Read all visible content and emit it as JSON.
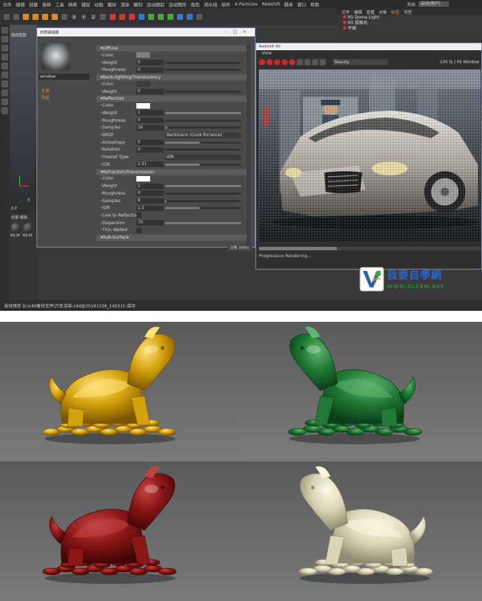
{
  "menubar": {
    "items": [
      "文件",
      "编辑",
      "创建",
      "选择",
      "工具",
      "网格",
      "捕捉",
      "动画",
      "模拟",
      "渲染",
      "雕刻",
      "运动跟踪",
      "运动图形",
      "角色",
      "流水线",
      "插件",
      "X-Particles",
      "Redshift",
      "脚本",
      "窗口",
      "帮助"
    ],
    "layout_label": "界面:",
    "layout_value": "启动(用户)"
  },
  "toolbar": {
    "x_label": "X",
    "y_label": "Y",
    "z_label": "Z"
  },
  "viewport": {
    "title": "透视视图",
    "axis_y": "Y",
    "axis_x": "X"
  },
  "timeline": {
    "frame": "0 F",
    "start": "0",
    "tick": "5"
  },
  "material_manager": {
    "tabs": "创建  编辑",
    "labels": [
      "RS M",
      "RS M"
    ]
  },
  "material_editor": {
    "title": "材质编辑器",
    "material_name": "window",
    "nav": [
      "主体",
      "指定"
    ],
    "sections": [
      {
        "title": "Diffuse",
        "rows": [
          {
            "label": "Color",
            "kind": "swatch",
            "swatch": "grey"
          },
          {
            "label": "Weight",
            "value": "0",
            "slider": 0.0
          },
          {
            "label": "Roughness",
            "value": "0",
            "slider": 0.0
          }
        ]
      },
      {
        "title": "Back-lighting/Translucency",
        "rows": [
          {
            "label": "Color",
            "kind": "swatch",
            "swatch": "dark"
          },
          {
            "label": "Weight",
            "value": "0",
            "slider": 0.0
          }
        ]
      },
      {
        "title": "Reflection",
        "rows": [
          {
            "label": "Color",
            "kind": "swatch",
            "swatch": "white"
          },
          {
            "label": "Weight",
            "value": "1",
            "slider": 1.0
          },
          {
            "label": "Roughness",
            "value": "0",
            "slider": 0.0
          },
          {
            "label": "Samples",
            "value": "16",
            "slider": 0.03
          },
          {
            "label": "BRDF",
            "kind": "dropdown",
            "value": "Beckmann (Cook-Torrance)"
          },
          {
            "label": "Anisotropy",
            "value": "0",
            "slider": 0.45
          },
          {
            "label": "Rotation",
            "value": "0",
            "slider": 0.0
          },
          {
            "label": "Fresnel Type",
            "kind": "dropdown",
            "value": "IOR"
          },
          {
            "label": "IOR",
            "value": "1.51",
            "slider": 0.45
          }
        ]
      },
      {
        "title": "Refraction/Transmission",
        "rows": [
          {
            "label": "Color",
            "kind": "swatch",
            "swatch": "white"
          },
          {
            "label": "Weight",
            "value": "1",
            "slider": 1.0
          },
          {
            "label": "Roughness",
            "value": "0",
            "slider": 0.0
          },
          {
            "label": "Samples",
            "value": "8",
            "slider": 0.02
          },
          {
            "label": "IOR",
            "value": "1.5",
            "slider": 0.45
          },
          {
            "label": "Link to Reflection",
            "kind": "check"
          },
          {
            "label": "Dispersion",
            "value": "70",
            "slider": 1.0
          },
          {
            "label": "Thin Walled",
            "kind": "check"
          }
        ]
      },
      {
        "title": "Sub-Surface",
        "rows": []
      }
    ]
  },
  "objects_panel": {
    "tabs": [
      "文件",
      "编辑",
      "查看",
      "对象",
      "标签",
      "书签"
    ],
    "items": [
      "RS Dome Light",
      "RS 摄像机",
      "平面"
    ]
  },
  "render_view": {
    "title": "Redshift RV",
    "menu": "View",
    "aov": "Beauty",
    "zoom": "130 %",
    "fit": "Fit Window",
    "status": "Progressive Rendering...",
    "progress": 0.35
  },
  "logo": {
    "text": "我要自學網",
    "url": "WWW.51ZXW.NET"
  },
  "bottom_button": "对象 (RPR)",
  "statusbar": {
    "text": "自动保存 G:\\c4d备份文件\\汽车渲染.c4d@20191106_145515 成功"
  },
  "renders": [
    {
      "material": "gold",
      "colors": {
        "bg_top": "#5a5a5a",
        "bg_bottom": "#7a7a7a",
        "light": "#ffe37a",
        "mid": "#d4a10e",
        "dark": "#7a5400"
      }
    },
    {
      "material": "jade",
      "colors": {
        "bg_top": "#5a5a5a",
        "bg_bottom": "#7b7b7b",
        "light": "#5fb56f",
        "mid": "#1f7a35",
        "dark": "#0b3d18"
      }
    },
    {
      "material": "red",
      "colors": {
        "bg_top": "#5a5a5a",
        "bg_bottom": "#7a7a7a",
        "light": "#c44444",
        "mid": "#8a1616",
        "dark": "#420606"
      }
    },
    {
      "material": "ivory",
      "colors": {
        "bg_top": "#5a5a5a",
        "bg_bottom": "#7a7a7a",
        "light": "#fbf6e0",
        "mid": "#dcd6b8",
        "dark": "#8f8a70"
      }
    }
  ]
}
